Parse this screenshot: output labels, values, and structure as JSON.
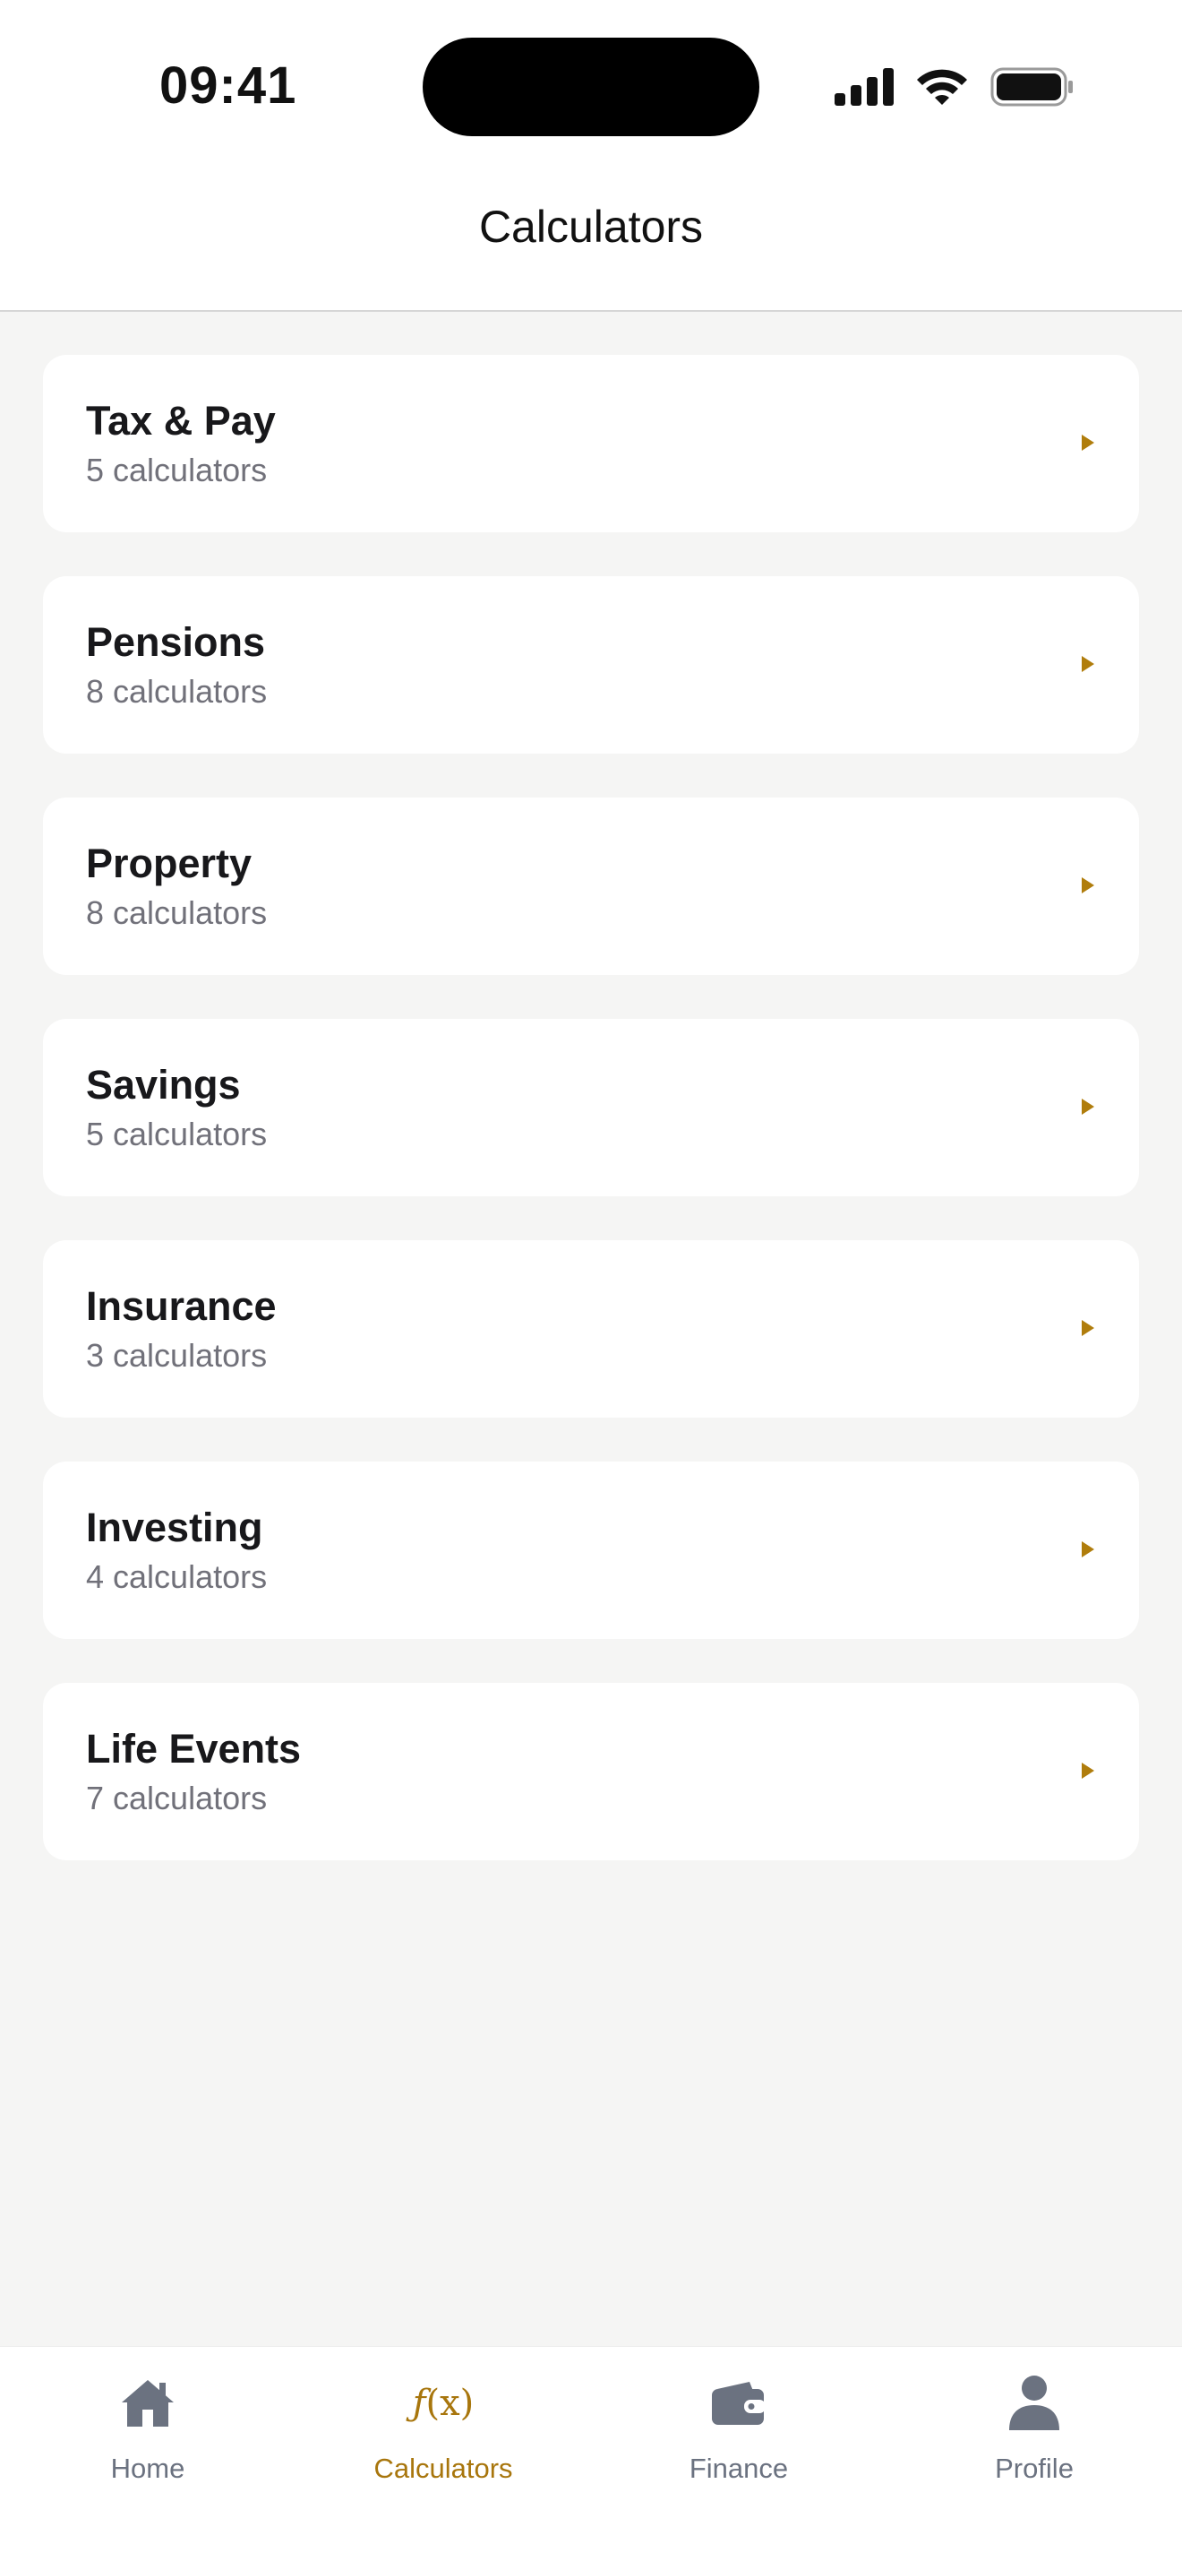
{
  "status_bar": {
    "time": "09:41"
  },
  "header": {
    "title": "Calculators"
  },
  "categories": [
    {
      "name": "Tax & Pay",
      "count": "5 calculators"
    },
    {
      "name": "Pensions",
      "count": "8 calculators"
    },
    {
      "name": "Property",
      "count": "8 calculators"
    },
    {
      "name": "Savings",
      "count": "5 calculators"
    },
    {
      "name": "Insurance",
      "count": "3 calculators"
    },
    {
      "name": "Investing",
      "count": "4 calculators"
    },
    {
      "name": "Life Events",
      "count": "7 calculators"
    }
  ],
  "tab_bar": {
    "items": [
      {
        "label": "Home",
        "icon": "home-icon",
        "active": false
      },
      {
        "label": "Calculators",
        "icon": "function-icon",
        "active": true
      },
      {
        "label": "Finance",
        "icon": "wallet-icon",
        "active": false
      },
      {
        "label": "Profile",
        "icon": "person-icon",
        "active": false
      }
    ]
  },
  "colors": {
    "accent": "#a8760d",
    "background": "#f5f5f4",
    "card": "#ffffff",
    "muted_text": "#71717a",
    "inactive_tab": "#6b7280"
  }
}
